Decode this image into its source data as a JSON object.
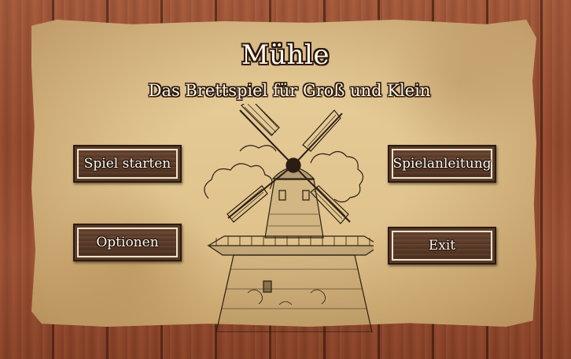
{
  "title": "Mühle",
  "subtitle": "Das Brettspiel für Groß und Klein",
  "menu": {
    "start": "Spiel starten",
    "rules": "Spielanleitung",
    "options": "Optionen",
    "exit": "Exit"
  },
  "colors": {
    "wood": "#93482c",
    "paper": "#e8cf9c",
    "button": "#5a3a26",
    "button_text": "#fffaf0"
  }
}
